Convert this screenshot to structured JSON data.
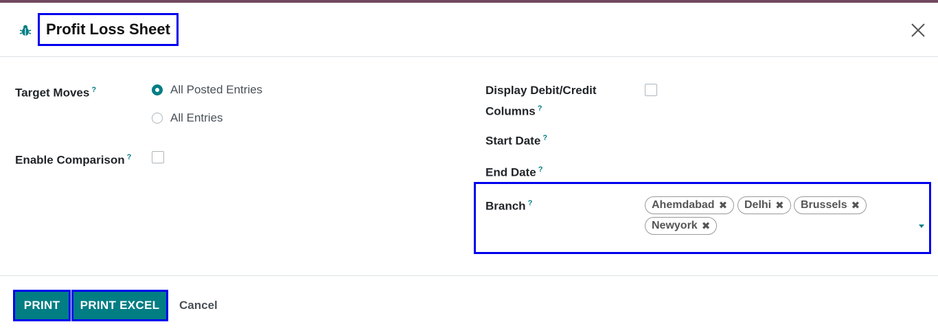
{
  "dialog": {
    "title": "Profit Loss Sheet",
    "icons": {
      "debug": "bug-icon",
      "close": "close-icon"
    }
  },
  "form": {
    "target_moves": {
      "label": "Target Moves",
      "help": "?",
      "options": [
        {
          "label": "All Posted Entries",
          "selected": true
        },
        {
          "label": "All Entries",
          "selected": false
        }
      ]
    },
    "enable_comparison": {
      "label": "Enable Comparison",
      "help": "?",
      "checked": false
    },
    "display_debit_credit": {
      "label_line1": "Display Debit/Credit",
      "label_line2": "Columns",
      "help": "?",
      "checked": false
    },
    "start_date": {
      "label": "Start Date",
      "help": "?",
      "value": ""
    },
    "end_date": {
      "label": "End Date",
      "help": "?",
      "value": ""
    },
    "branch": {
      "label": "Branch",
      "help": "?",
      "tags": [
        "Ahemdabad",
        "Delhi",
        "Brussels",
        "Newyork"
      ],
      "remove_symbol": "✖"
    }
  },
  "footer": {
    "print_label": "PRINT",
    "print_excel_label": "PRINT EXCEL",
    "cancel_label": "Cancel"
  },
  "colors": {
    "accent": "#017e84",
    "highlight_border": "#0000ee",
    "top_bar": "#71495f"
  }
}
